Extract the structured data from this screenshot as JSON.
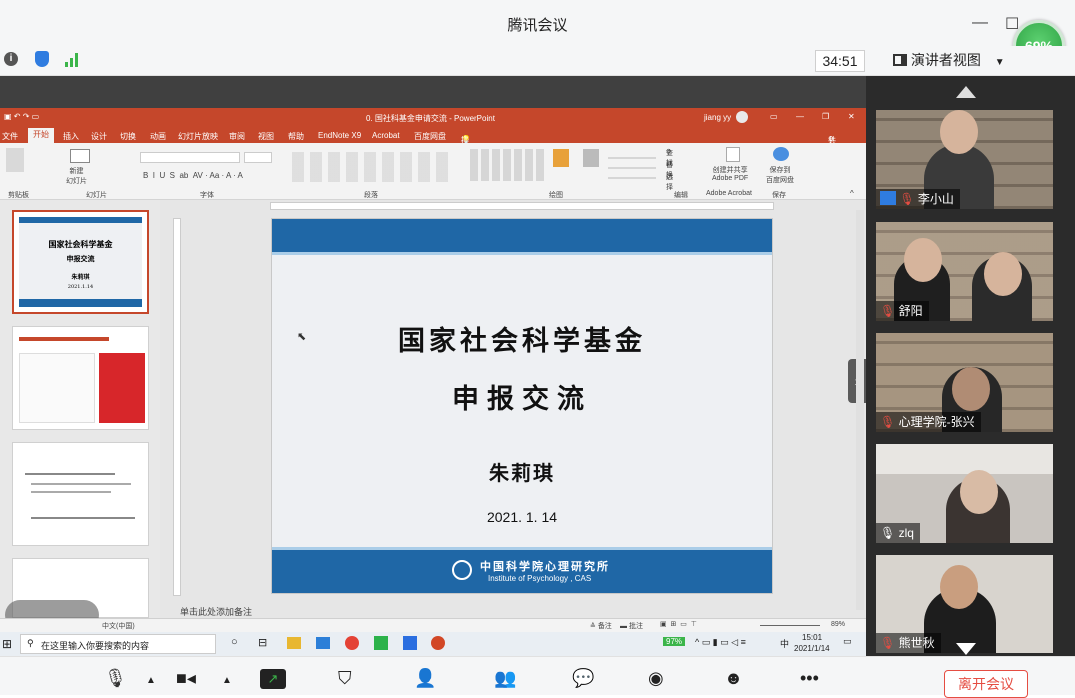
{
  "window": {
    "title": "腾讯会议"
  },
  "status": {
    "battery": "69%",
    "timer": "34:51",
    "view_mode": "演讲者视图"
  },
  "ppt": {
    "doc_title": "0. 国社科基金申请交流 - PowerPoint",
    "user": "jiang yy",
    "share_label": "共享",
    "tabs": [
      "文件",
      "开始",
      "插入",
      "设计",
      "切换",
      "动画",
      "幻灯片放映",
      "审阅",
      "视图",
      "帮助",
      "EndNote X9",
      "Acrobat",
      "百度网盘",
      "操作说明搜索"
    ],
    "ribbon_groups": [
      "剪贴板",
      "幻灯片",
      "字体",
      "段落",
      "绘图",
      "编辑",
      "Adobe Acrobat",
      "保存"
    ],
    "ribbon_items": {
      "new_slide": "新建\n幻灯片",
      "find": "查找",
      "replace": "替换",
      "select": "选择",
      "create_share": "创建并共享\nAdobe PDF",
      "save_baidu": "保存到\n百度网盘"
    },
    "slide": {
      "title_line1": "国家社会科学基金",
      "title_line2": "申报交流",
      "author": "朱莉琪",
      "date": "2021. 1. 14",
      "org_cn": "中国科学院心理研究所",
      "org_en": "Institute of Psychology , CAS"
    },
    "thumb1": {
      "line1": "国家社会科学基金",
      "line2": "申报交流",
      "line3": "朱莉琪",
      "line4": "2021.1.14"
    },
    "notes_placeholder": "单击此处添加备注",
    "status_lang": "中文(中国)",
    "status_notes": "备注",
    "status_comments": "批注",
    "zoom": "89%"
  },
  "taskbar": {
    "search_placeholder": "在这里输入你要搜索的内容",
    "battery": "97%",
    "time": "15:01",
    "date": "2021/1/14",
    "ime": "中"
  },
  "participants": [
    {
      "name": "李小山"
    },
    {
      "name": "舒阳"
    },
    {
      "name": "心理学院-张兴"
    },
    {
      "name": "zlq"
    },
    {
      "name": "熊世秋"
    }
  ],
  "bottom": {
    "leave": "离开会议"
  }
}
